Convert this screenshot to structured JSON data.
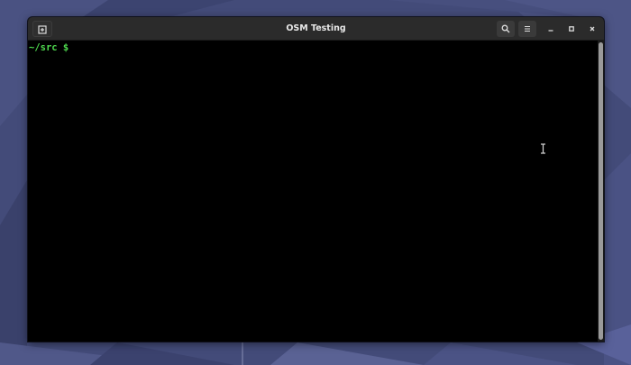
{
  "window": {
    "title": "OSM Testing"
  },
  "headerbar": {
    "new_tab_icon": "new-tab-icon",
    "search_icon": "search-icon",
    "menu_icon": "hamburger-menu-icon",
    "minimize_icon": "minimize-icon",
    "maximize_icon": "maximize-icon",
    "close_icon": "close-icon"
  },
  "terminal": {
    "prompt": "~/src $",
    "prompt_color": "#4ed94e",
    "background": "#000000"
  },
  "colors": {
    "desktop_background": "#3f4775",
    "headerbar": "#2b2b2b"
  }
}
